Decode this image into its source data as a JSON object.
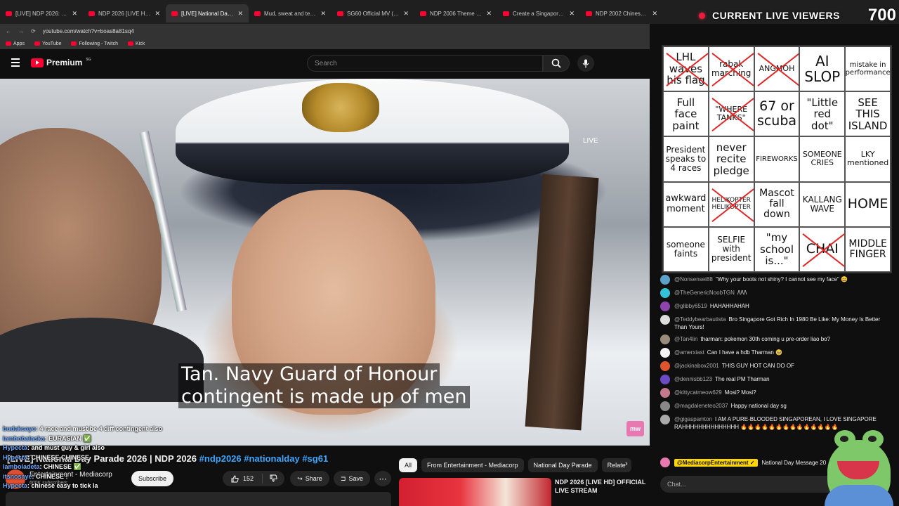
{
  "browser": {
    "tabs": [
      {
        "title": "[LIVE] NDP 2026: Singapore cel",
        "active": false
      },
      {
        "title": "NDP 2026 [LIVE HD] OFFICIAL L",
        "active": false
      },
      {
        "title": "[LIVE] National Day Parade",
        "active": true
      },
      {
        "title": "Mud, sweat and tears: Reality o",
        "active": false
      },
      {
        "title": "SG60 Official MV (Koala Keys) -",
        "active": false
      },
      {
        "title": "NDP 2006 Theme Song - My Is",
        "active": false
      },
      {
        "title": "Create a Singapore NDP Song",
        "active": false
      },
      {
        "title": "NDP 2002 Chinese Theme Son",
        "active": false
      }
    ],
    "url": "youtube.com/watch?v=boas8a81sq4",
    "bookmarks": [
      "Apps",
      "YouTube",
      "Following - Twitch",
      "Kick"
    ]
  },
  "youtube": {
    "logo_text": "Premium",
    "logo_region": "SG",
    "search_placeholder": "Search"
  },
  "video": {
    "live_label": "LIVE",
    "caption_line1": "Tan. Navy Guard of Honour",
    "caption_line2": "contingent is made up of men",
    "title_text": "[LIVE] National Day Parade 2026 | NDP 2026",
    "title_tags": "#ndp2026 #nationalday #sg61",
    "channel": "Entertainment - Mediacorp",
    "subscribers": "600K subscribers",
    "subscribe_label": "Subscribe",
    "like_count": "152",
    "share_label": "Share",
    "save_label": "Save"
  },
  "overlay_chat": [
    {
      "user": "budaksayo",
      "text": "4 race and must be 4 diff contingent also"
    },
    {
      "user": "lambobalaska",
      "text": "EURASIAN ✅"
    },
    {
      "user": "Hypecta",
      "text": "and must guy & girl also"
    },
    {
      "user": "Hypecta",
      "text": "CHINESE CHINESE"
    },
    {
      "user": "lamboladeta",
      "text": "CHINESE ✅"
    },
    {
      "user": "itsnosaye",
      "text": "CHINESE !"
    },
    {
      "user": "Hypecta",
      "text": "chinese easy to tick la"
    }
  ],
  "recommendations": {
    "chips": [
      "All",
      "From Entertainment - Mediacorp",
      "National Day Parade",
      "Relate"
    ],
    "first_title": "NDP 2026 [LIVE HD] OFFICIAL LIVE STREAM"
  },
  "stream_overlay": {
    "viewers_label": "CURRENT LIVE VIEWERS",
    "viewers_count": "700"
  },
  "bingo": [
    {
      "text": "LHL waves his flag",
      "x": true,
      "size": 15
    },
    {
      "text": "rabak marching",
      "x": true,
      "size": 12
    },
    {
      "text": "ANGMOH",
      "x": true,
      "size": 11
    },
    {
      "text": "AI SLOP",
      "x": false,
      "size": 20
    },
    {
      "text": "mistake in performance",
      "x": false,
      "size": 10
    },
    {
      "text": "Full face paint",
      "x": false,
      "size": 15
    },
    {
      "text": "\"WHERE TANKS\"",
      "x": true,
      "size": 11
    },
    {
      "text": "67 or scuba",
      "x": false,
      "size": 19
    },
    {
      "text": "\"Little red dot\"",
      "x": false,
      "size": 15
    },
    {
      "text": "SEE THIS ISLAND",
      "x": false,
      "size": 15
    },
    {
      "text": "President speaks to 4 races",
      "x": false,
      "size": 12
    },
    {
      "text": "never recite pledge",
      "x": false,
      "size": 15
    },
    {
      "text": "FIREWORKS",
      "x": false,
      "size": 10
    },
    {
      "text": "SOMEONE CRIES",
      "x": false,
      "size": 11
    },
    {
      "text": "LKY mentioned",
      "x": false,
      "size": 11
    },
    {
      "text": "awkward moment",
      "x": false,
      "size": 13
    },
    {
      "text": "HELIKOPTER HELIKOPTER",
      "x": true,
      "size": 9
    },
    {
      "text": "Mascot fall down",
      "x": false,
      "size": 14
    },
    {
      "text": "KALLANG WAVE",
      "x": false,
      "size": 12
    },
    {
      "text": "HOME",
      "x": false,
      "size": 19
    },
    {
      "text": "someone faints",
      "x": false,
      "size": 12
    },
    {
      "text": "SELFIE with president",
      "x": false,
      "size": 12
    },
    {
      "text": "\"my school is...\"",
      "x": false,
      "size": 15
    },
    {
      "text": "CHAI",
      "x": true,
      "size": 19
    },
    {
      "text": "MIDDLE FINGER",
      "x": false,
      "size": 14
    }
  ],
  "live_chat": [
    {
      "user": "@Nonsensei88",
      "text": "\"Why your boots not shiny? I cannot see my face\" 😄",
      "color": "#5ba0c9"
    },
    {
      "user": "@TheGenericNoobTGN",
      "text": "/\\/\\/\\",
      "color": "#34c3d6"
    },
    {
      "user": "@glibby6519",
      "text": "HAHAHHAHAH",
      "color": "#8e44ad"
    },
    {
      "user": "@Teddybearbautista",
      "text": "Bro Singapore Got Rich In 1980 Be Like: My Money Is Better Than Yours!",
      "color": "#dddddd"
    },
    {
      "user": "@Tan4lin",
      "text": "tharman: pokemon 30th coming u pre-order liao bo?",
      "color": "#9a8c7a"
    },
    {
      "user": "@amerxiast",
      "text": "Can I have a hdb Tharman 🥹",
      "color": "#f5f5f5"
    },
    {
      "user": "@jackinabox2001",
      "text": "THIS GUY HOT CAN DO OF",
      "color": "#e0552d"
    },
    {
      "user": "@dennisbb123",
      "text": "The real PM Tharman",
      "color": "#6a4bc4"
    },
    {
      "user": "@kittycatmeow629",
      "text": "Mosi? Mosi?",
      "color": "#c47a8c"
    },
    {
      "user": "@magdaleneteo2037",
      "text": "Happy national day sg",
      "color": "#888888"
    },
    {
      "user": "@gigaspamton",
      "text": "I AM A PURE-BLOODED SINGAPOREAN, I LOVE SINGAPORE RAHHHHHHHHHHHHHH 🔥🔥🔥🔥🔥🔥🔥🔥🔥🔥🔥🔥🔥🔥",
      "color": "#aaaaaa"
    }
  ],
  "pinned": {
    "channel": "@MediacorpEntertainment ✓",
    "text": "National Day Message 20"
  },
  "chat_placeholder": "Chat..."
}
